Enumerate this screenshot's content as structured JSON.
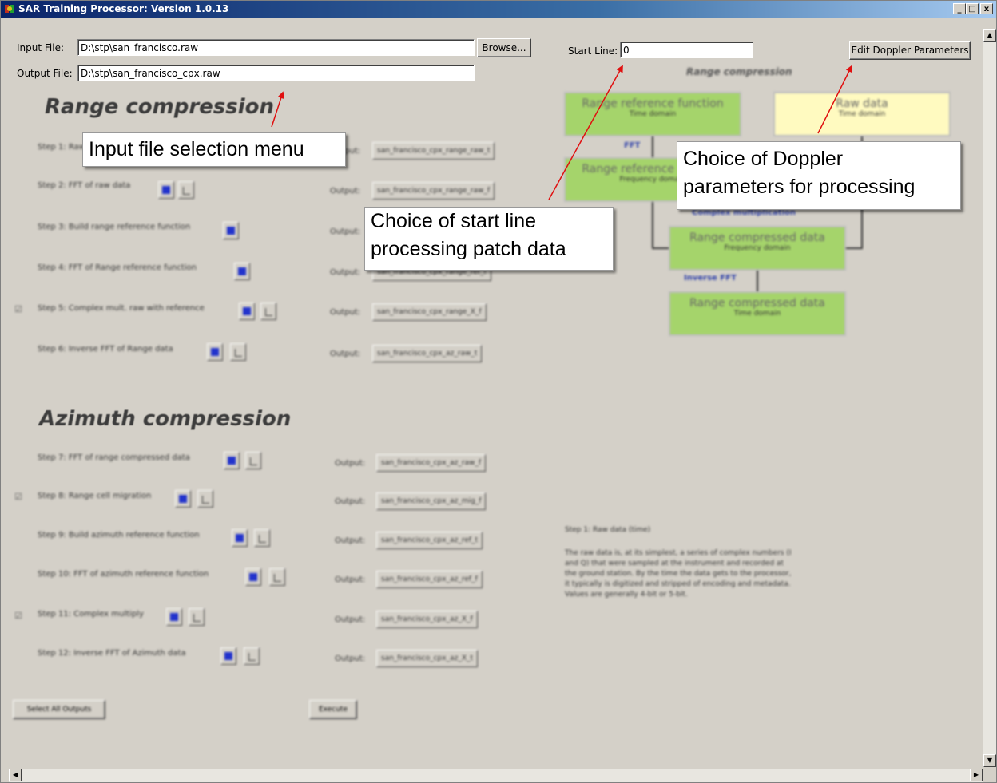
{
  "window": {
    "title": "SAR Training Processor: Version 1.0.13",
    "buttons": [
      "_",
      "□",
      "x"
    ]
  },
  "io": {
    "input_label": "Input File:",
    "input_value": "D:\\stp\\san_francisco.raw",
    "browse_label": "Browse...",
    "output_label": "Output File:",
    "output_value": "D:\\stp\\san_francisco_cpx.raw",
    "start_line_label": "Start Line:",
    "start_line_value": "0",
    "edit_doppler_label": "Edit Doppler Parameters"
  },
  "range": {
    "heading": "Range compression",
    "steps": [
      {
        "label": "Step 1: Raw data (time)",
        "output": "san_francisco_cpx_range_raw_t",
        "checked": false
      },
      {
        "label": "Step 2: FFT of raw data",
        "output": "san_francisco_cpx_range_raw_f",
        "checked": false
      },
      {
        "label": "Step 3: Build range reference function",
        "output": "san_francisco_cpx_range_ref_t",
        "checked": false
      },
      {
        "label": "Step 4: FFT of Range reference function",
        "output": "san_francisco_cpx_range_ref_f",
        "checked": false
      },
      {
        "label": "Step 5: Complex mult. raw with reference",
        "output": "san_francisco_cpx_range_X_f",
        "checked": true
      },
      {
        "label": "Step 6: Inverse FFT of Range data",
        "output": "san_francisco_cpx_az_raw_t",
        "checked": false
      }
    ]
  },
  "azimuth": {
    "heading": "Azimuth compression",
    "steps": [
      {
        "label": "Step 7: FFT of range compressed data",
        "output": "san_francisco_cpx_az_raw_f",
        "checked": false
      },
      {
        "label": "Step 8: Range cell migration",
        "output": "san_francisco_cpx_az_mig_f",
        "checked": true
      },
      {
        "label": "Step 9: Build azimuth reference function",
        "output": "san_francisco_cpx_az_ref_t",
        "checked": false
      },
      {
        "label": "Step 10: FFT of azimuth reference function",
        "output": "san_francisco_cpx_az_ref_f",
        "checked": false
      },
      {
        "label": "Step 11: Complex multiply",
        "output": "san_francisco_cpx_az_X_f",
        "checked": true
      },
      {
        "label": "Step 12: Inverse FFT of Azimuth data",
        "output": "san_francisco_cpx_az_X_t",
        "checked": false
      }
    ]
  },
  "output_label": "Output:",
  "bottom": {
    "select_all": "Select All Outputs",
    "execute": "Execute"
  },
  "diagram": {
    "title": "Range compression",
    "ref_time": {
      "t1": "Range reference function",
      "t2": "Time domain"
    },
    "raw_time": {
      "t1": "Raw data",
      "t2": "Time domain"
    },
    "ref_freq": {
      "t1": "Range reference function",
      "t2": "Frequency domain"
    },
    "fft": "FFT",
    "complex_mult": "Complex multiplication",
    "rc_freq": {
      "t1": "Range compressed data",
      "t2": "Frequency domain"
    },
    "inverse_fft": "Inverse FFT",
    "rc_time": {
      "t1": "Range compressed data",
      "t2": "Time domain"
    }
  },
  "description": {
    "title": "Step 1: Raw data (time)",
    "lines": [
      "The raw data is, at its simplest, a series of complex numbers (I",
      "and Q) that were sampled at the instrument and recorded at",
      "the ground station. By the time the data gets to the processor,",
      "it typically is digitized and stripped of encoding and metadata.",
      "Values are generally 4-bit or 5-bit."
    ]
  },
  "callouts": {
    "input": "Input file selection menu",
    "start_line_1": "Choice of start line",
    "start_line_2": "processing patch data",
    "doppler_1": "Choice of Doppler",
    "doppler_2": "parameters for processing"
  },
  "colors": {
    "box_green": "#a5d46b",
    "box_yellow": "#fffac0",
    "annotation_arrow": "#e01010"
  }
}
